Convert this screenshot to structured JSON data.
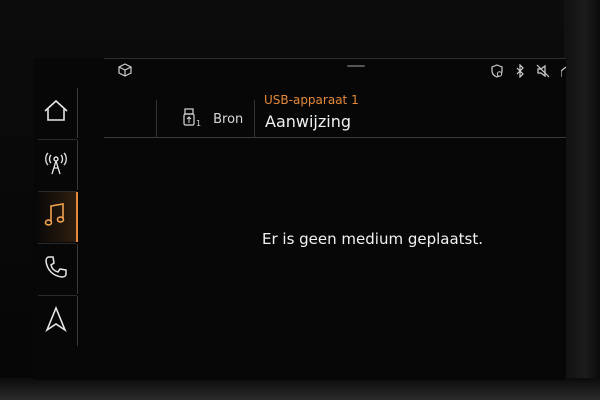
{
  "status_bar": {
    "left_icon": "package-cube-icon",
    "right_icons": [
      "location-shield-icon",
      "bluetooth-icon",
      "muted-speaker-icon",
      "home-partial-icon"
    ]
  },
  "sidebar": {
    "items": [
      {
        "name": "home",
        "icon": "home-icon",
        "active": false
      },
      {
        "name": "radio",
        "icon": "radio-antenna-icon",
        "active": false
      },
      {
        "name": "media",
        "icon": "music-note-icon",
        "active": true
      },
      {
        "name": "phone",
        "icon": "phone-icon",
        "active": false
      },
      {
        "name": "navigation",
        "icon": "navigation-arrow-icon",
        "active": false
      }
    ]
  },
  "header": {
    "source_button_label": "Bron",
    "source_sub_index": "1",
    "source_name": "USB-apparaat 1",
    "folder_name": "Aanwijzing"
  },
  "main": {
    "message": "Er is geen medium geplaatst."
  },
  "colors": {
    "accent": "#e58a3a",
    "background": "#070707",
    "text": "#f0f0f0",
    "divider": "#3a3a3a"
  }
}
